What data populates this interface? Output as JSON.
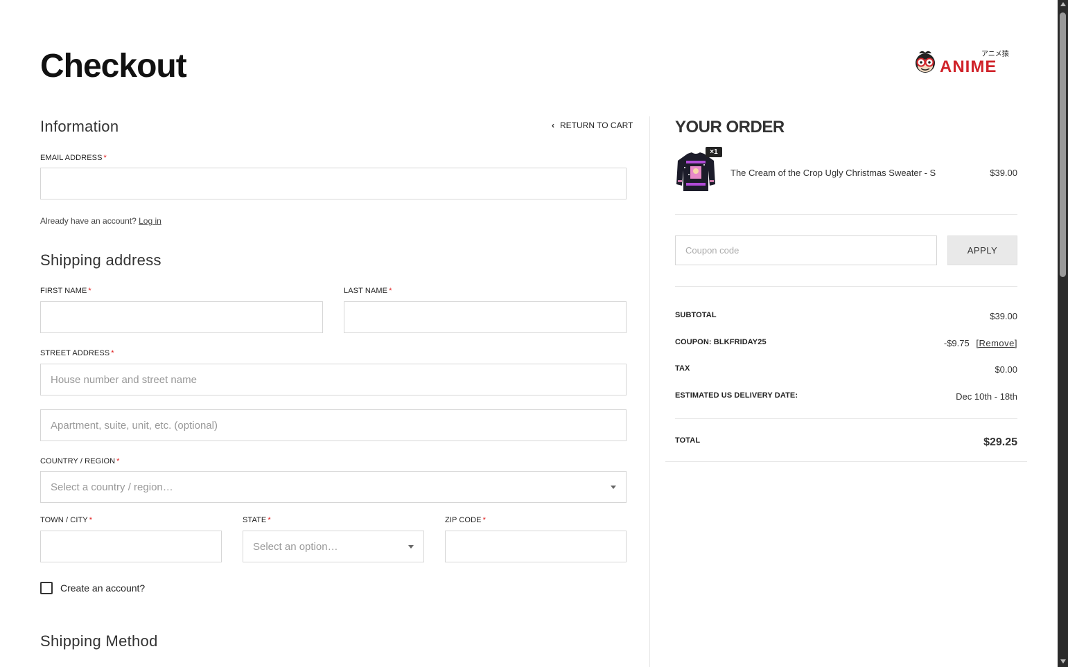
{
  "page": {
    "title": "Checkout"
  },
  "logo": {
    "text": "ANIME",
    "kana": "アニメ猿",
    "icon": "monkey-glasses-icon",
    "brand_color": "#d0232a"
  },
  "information": {
    "title": "Information",
    "return_link": "RETURN TO CART",
    "email_label": "EMAIL ADDRESS",
    "email_value": "",
    "already_text": "Already have an account?",
    "login_link": "Log in"
  },
  "shipping": {
    "title": "Shipping address",
    "first_name_label": "FIRST NAME",
    "last_name_label": "LAST NAME",
    "street_label": "STREET ADDRESS",
    "street_placeholder": "House number and street name",
    "apt_placeholder": "Apartment, suite, unit, etc. (optional)",
    "country_label": "COUNTRY / REGION",
    "country_placeholder": "Select a country / region…",
    "city_label": "TOWN / CITY",
    "state_label": "STATE",
    "state_placeholder": "Select an option…",
    "zip_label": "ZIP CODE",
    "required_mark": "*",
    "create_account": "Create an account?"
  },
  "shipping_method": {
    "title": "Shipping Method"
  },
  "order": {
    "title": "YOUR ORDER",
    "items": [
      {
        "name": "The Cream of the Crop Ugly Christmas Sweater - S",
        "price": "$39.00",
        "qty": "×1"
      }
    ],
    "coupon_placeholder": "Coupon code",
    "apply_label": "APPLY",
    "subtotal_label": "SUBTOTAL",
    "subtotal_value": "$39.00",
    "coupon_label": "COUPON: BLKFRIDAY25",
    "coupon_value": "-$9.75",
    "remove_label": "[Remove]",
    "tax_label": "TAX",
    "tax_value": "$0.00",
    "delivery_label": "ESTIMATED US DELIVERY DATE:",
    "delivery_value": "Dec 10th - 18th",
    "total_label": "TOTAL",
    "total_value": "$29.25"
  }
}
